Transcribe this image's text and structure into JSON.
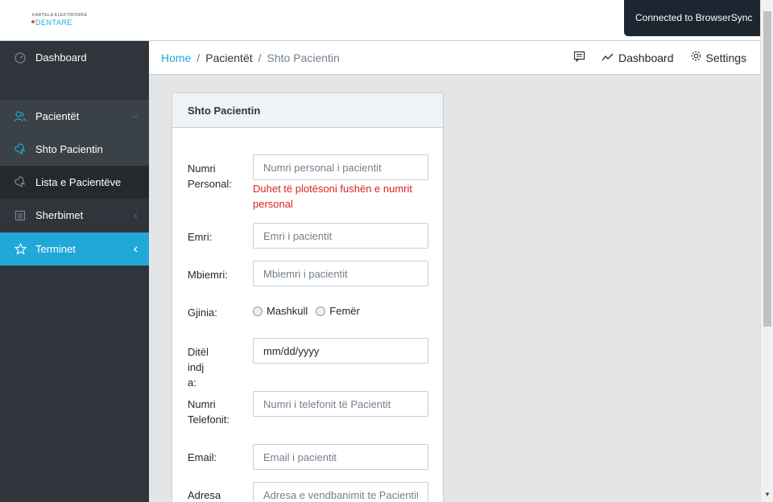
{
  "header": {
    "brand_top": "KARTELA ELEKTRONIKE",
    "brand_bottom": "DENTARE",
    "browsersync_notice": "Connected to BrowserSync"
  },
  "sidebar": {
    "items": [
      {
        "label": "Dashboard",
        "icon": "speedometer-icon"
      },
      {
        "label": "Pacientët",
        "icon": "users-icon",
        "chevron": "chevron-down-icon"
      },
      {
        "label": "Shto Pacientin",
        "icon": "tooth-icon"
      },
      {
        "label": "Lista e Pacientëve",
        "icon": "tooth-icon"
      },
      {
        "label": "Sherbimet",
        "icon": "notebook-icon",
        "chevron": "chevron-left-icon"
      },
      {
        "label": "Terminet",
        "icon": "star-icon",
        "chevron": "chevron-left-icon"
      }
    ]
  },
  "breadcrumb": {
    "home": "Home",
    "pacientet": "Pacientët",
    "current": "Shto Pacientin",
    "separator": "/",
    "dashboard_label": "Dashboard",
    "settings_label": "Settings"
  },
  "form": {
    "title": "Shto Pacientin",
    "numri_personal_label": "Numri Personal:",
    "numri_personal_placeholder": "Numri personal i pacientit",
    "numri_personal_error": "Duhet të plotësoni fushën e numrit personal",
    "emri_label": "Emri:",
    "emri_placeholder": "Emri i pacientit",
    "mbiemri_label": "Mbiemri:",
    "mbiemri_placeholder": "Mbiemri i pacientit",
    "gjinia_label": "Gjinia:",
    "gjinia_options": [
      "Mashkull",
      "Femër"
    ],
    "ditelindja_label": "Ditëlindja:",
    "ditelindja_value": "mm/dd/yyyy",
    "telefoni_label": "Numri Telefonit:",
    "telefoni_placeholder": "Numri i telefonit të Pacientit",
    "email_label": "Email:",
    "email_placeholder": "Email i pacientit",
    "adresa_label": "Adresa",
    "adresa_placeholder": "Adresa e vendbanimit te Pacientit"
  },
  "colors": {
    "accent": "#20a8d8",
    "sidebar_bg": "#2f353a",
    "error": "#e02020"
  }
}
